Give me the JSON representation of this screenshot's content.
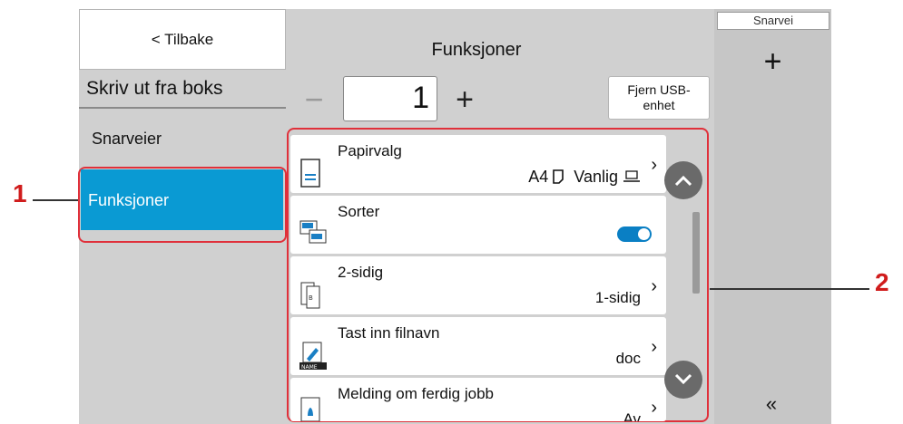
{
  "left": {
    "back_label": "< Tilbake",
    "box_title": "Skriv ut fra boks",
    "nav": [
      {
        "label": "Snarveier"
      },
      {
        "label": "Funksjoner"
      }
    ]
  },
  "main": {
    "title": "Funksjoner",
    "copies": "1",
    "minus": "−",
    "plus": "+",
    "usb_button_line1": "Fjern USB-",
    "usb_button_line2": "enhet",
    "items": [
      {
        "label": "Papirvalg",
        "value": "A4",
        "value2": "Vanlig",
        "icon": "paper-icon"
      },
      {
        "label": "Sorter",
        "toggle": "on",
        "icon": "collate-icon"
      },
      {
        "label": "2-sidig",
        "value": "1-sidig",
        "icon": "duplex-icon"
      },
      {
        "label": "Tast inn filnavn",
        "value": "doc",
        "icon": "filename-icon"
      },
      {
        "label": "Melding om ferdig jobb",
        "value": "Av",
        "icon": "notification-icon"
      }
    ]
  },
  "right": {
    "shortcut_label": "Snarvei",
    "add": "+",
    "collapse": "«"
  },
  "callouts": [
    "1",
    "2"
  ],
  "colors": {
    "accent": "#0a9ad3",
    "highlight": "#e0303a",
    "callout": "#d01c1c"
  }
}
